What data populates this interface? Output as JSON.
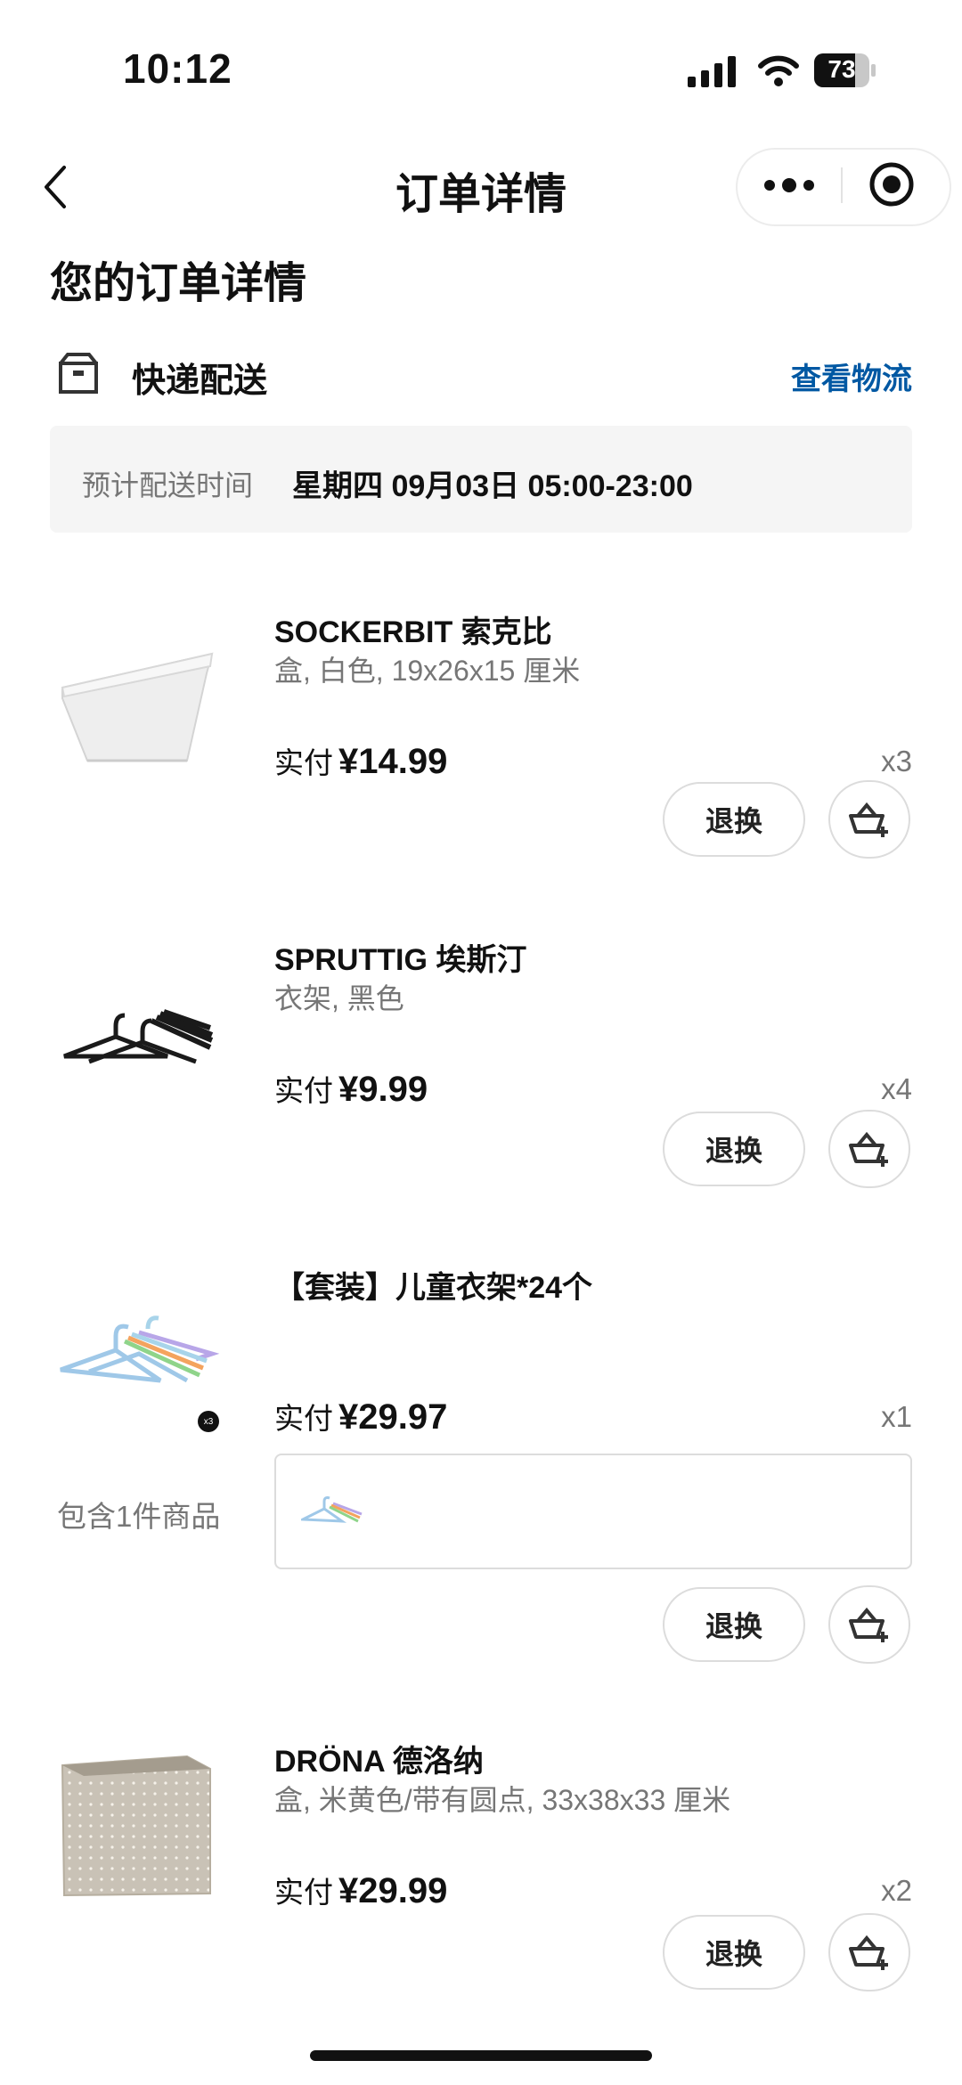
{
  "status_bar": {
    "time": "10:12",
    "battery": "73"
  },
  "nav": {
    "title": "订单详情"
  },
  "page_heading": "您的订单详情",
  "shipment": {
    "method": "快递配送",
    "track_link": "查看物流",
    "eta_label": "预计配送时间",
    "eta_value": "星期四 09月03日 05:00-23:00"
  },
  "paid_label": "实付",
  "currency": "¥",
  "return_label": "退换",
  "items": [
    {
      "name": "SOCKERBIT 索克比",
      "desc": "盒, 白色, 19x26x15 厘米",
      "price": "14.99",
      "qty": "x3",
      "icon": "white-storage-box"
    },
    {
      "name": "SPRUTTIG 埃斯汀",
      "desc": "衣架, 黑色",
      "price": "9.99",
      "qty": "x4",
      "icon": "black-hangers"
    },
    {
      "name": "【套装】儿童衣架*24个",
      "desc": "",
      "price": "29.97",
      "qty": "x1",
      "icon": "colorful-hangers",
      "badge": "x3",
      "contains": "包含1件商品"
    },
    {
      "name": "DRÖNA 德洛纳",
      "desc": "盒, 米黄色/带有圆点, 33x38x33 厘米",
      "price": "29.99",
      "qty": "x2",
      "icon": "beige-dotted-box"
    }
  ],
  "colors": {
    "accent": "#0058a3",
    "muted": "#767676",
    "panel": "#f5f5f5"
  }
}
